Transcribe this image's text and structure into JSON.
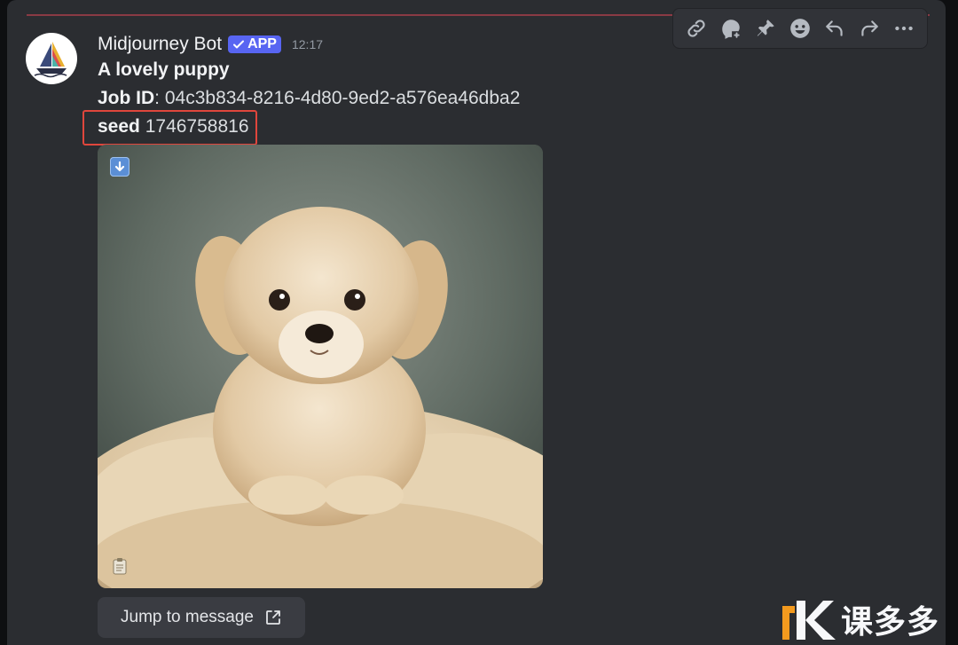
{
  "message": {
    "author": "Midjourney Bot",
    "app_badge": "APP",
    "timestamp": "12:17",
    "title": "A lovely puppy",
    "job_label": "Job ID",
    "job_sep": ":",
    "job_id": "04c3b834-8216-4d80-9ed2-a576ea46dba2",
    "seed_label": "seed",
    "seed_value": "1746758816",
    "jump_label": "Jump to message"
  },
  "attachment": {
    "download_icon": "download-arrow-icon",
    "clipboard_icon": "clipboard-icon"
  },
  "toolbar": {
    "items": [
      "link-icon",
      "reply-thread-icon",
      "pin-icon",
      "reaction-icon",
      "reply-icon",
      "forward-icon",
      "more-icon"
    ]
  },
  "watermark": {
    "text": "课多多"
  },
  "colors": {
    "accent": "#5865f2",
    "highlight": "#e0463c",
    "new_divider": "#8a3a44",
    "background": "#2b2d31"
  }
}
